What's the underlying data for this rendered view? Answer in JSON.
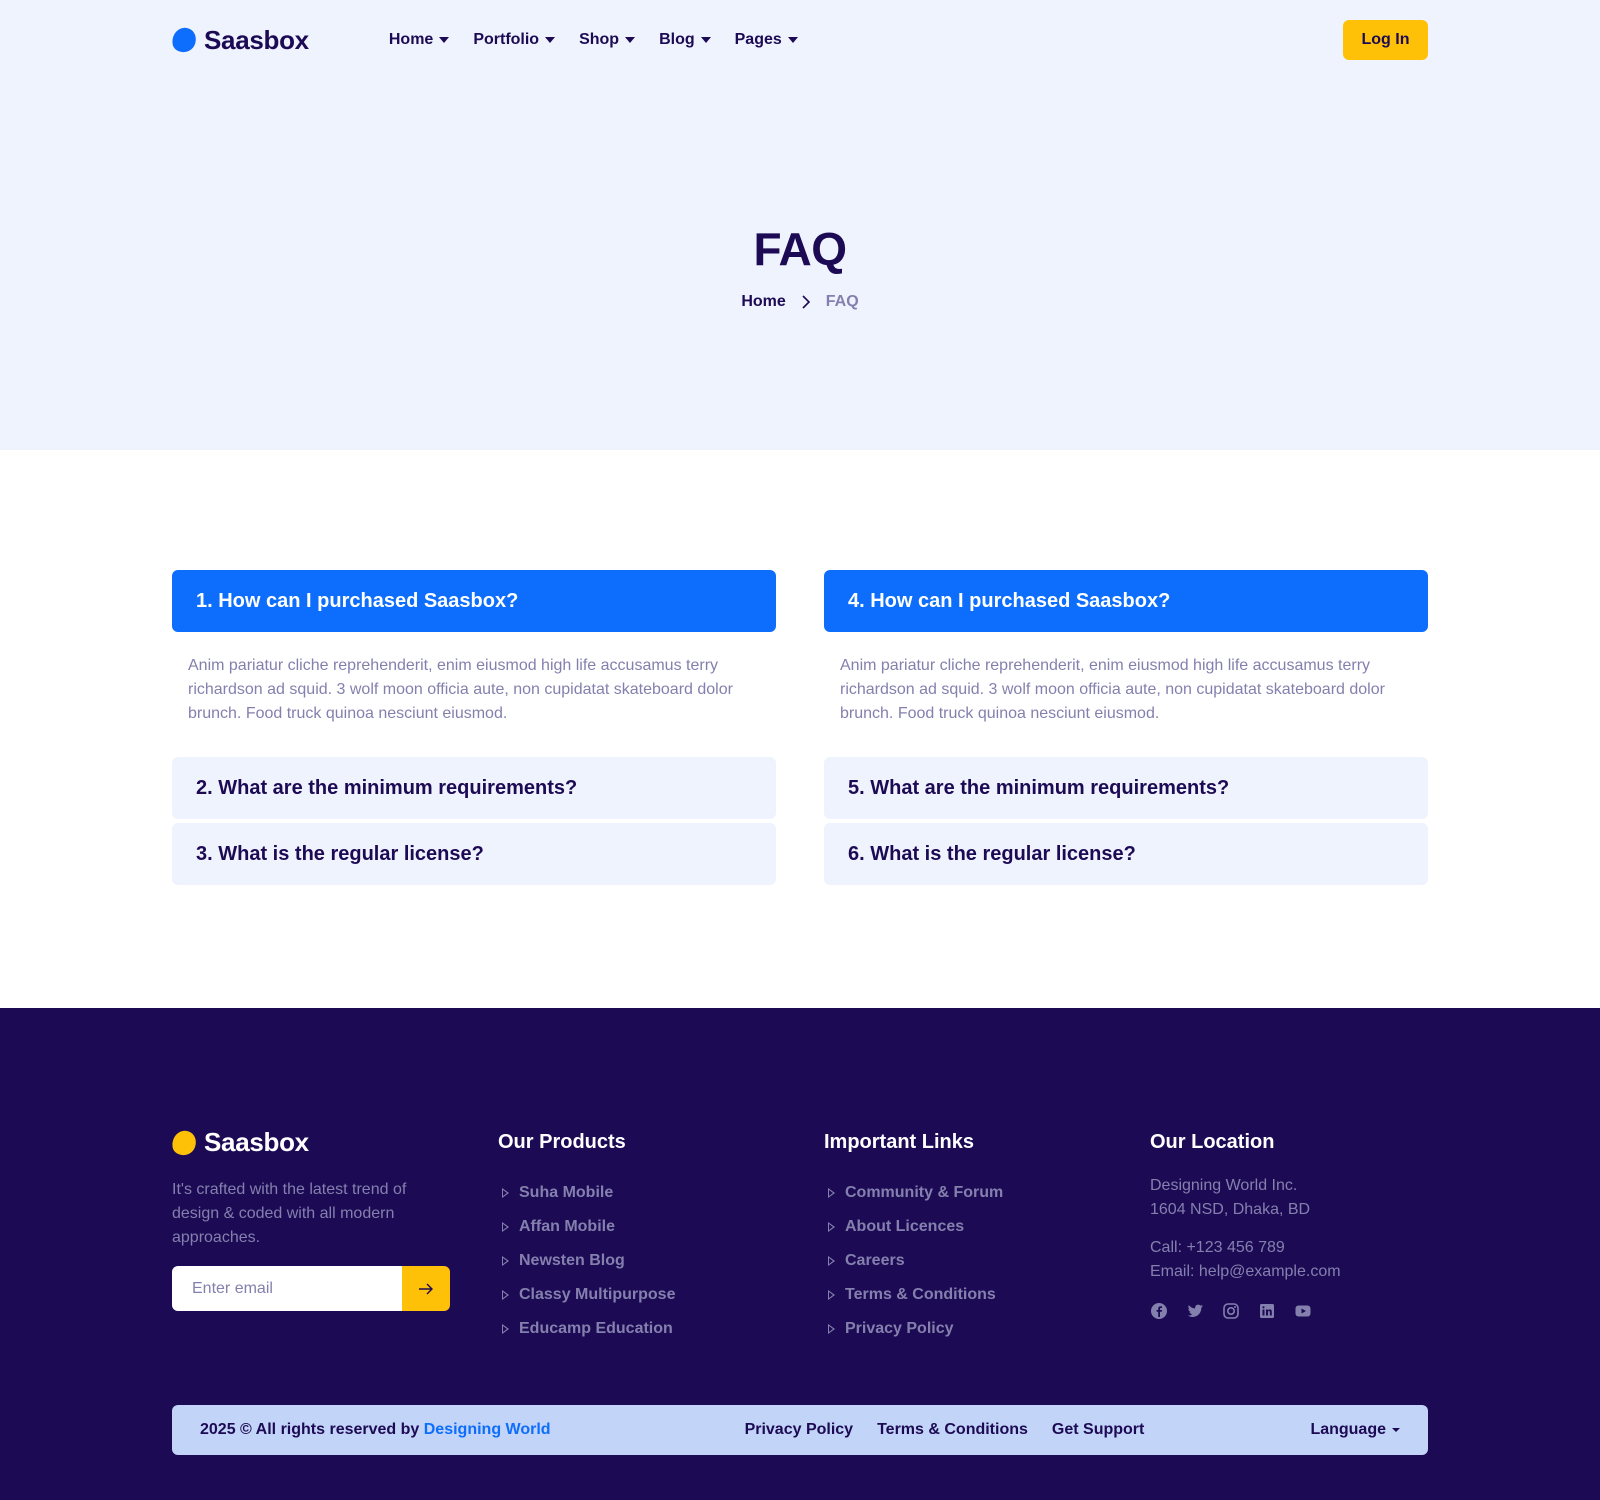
{
  "brand": {
    "name": "Saasbox"
  },
  "nav": {
    "items": [
      {
        "label": "Home"
      },
      {
        "label": "Portfolio"
      },
      {
        "label": "Shop"
      },
      {
        "label": "Blog"
      },
      {
        "label": "Pages"
      }
    ],
    "login_label": "Log In"
  },
  "hero": {
    "title": "FAQ",
    "breadcrumb": {
      "home": "Home",
      "current": "FAQ"
    }
  },
  "faq": {
    "left": [
      {
        "question": "1. How can I purchased Saasbox?",
        "answer": "Anim pariatur cliche reprehenderit, enim eiusmod high life accusamus terry richardson ad squid. 3 wolf moon officia aute, non cupidatat skateboard dolor brunch. Food truck quinoa nesciunt eiusmod.",
        "expanded": true
      },
      {
        "question": "2. What are the minimum requirements?",
        "expanded": false
      },
      {
        "question": "3. What is the regular license?",
        "expanded": false
      }
    ],
    "right": [
      {
        "question": "4. How can I purchased Saasbox?",
        "answer": "Anim pariatur cliche reprehenderit, enim eiusmod high life accusamus terry richardson ad squid. 3 wolf moon officia aute, non cupidatat skateboard dolor brunch. Food truck quinoa nesciunt eiusmod.",
        "expanded": true
      },
      {
        "question": "5. What are the minimum requirements?",
        "expanded": false
      },
      {
        "question": "6. What is the regular license?",
        "expanded": false
      }
    ]
  },
  "footer": {
    "brand": "Saasbox",
    "description": "It's crafted with the latest trend of design & coded with all modern approaches.",
    "email_placeholder": "Enter email",
    "products": {
      "heading": "Our Products",
      "items": [
        "Suha Mobile",
        "Affan Mobile",
        "Newsten Blog",
        "Classy Multipurpose",
        "Educamp Education"
      ]
    },
    "links": {
      "heading": "Important Links",
      "items": [
        "Community & Forum",
        "About Licences",
        "Careers",
        "Terms & Conditions",
        "Privacy Policy"
      ]
    },
    "location": {
      "heading": "Our Location",
      "address_line1": "Designing World Inc.",
      "address_line2": "1604 NSD, Dhaka, BD",
      "phone": "Call: +123 456 789",
      "email": "Email: help@example.com",
      "socials": [
        "facebook-icon",
        "twitter-icon",
        "instagram-icon",
        "linkedin-icon",
        "youtube-icon"
      ]
    },
    "bottom": {
      "copyright_prefix": "2025 © All rights reserved by ",
      "copyright_link": "Designing World",
      "links": [
        "Privacy Policy",
        "Terms & Conditions",
        "Get Support"
      ],
      "language_label": "Language"
    }
  },
  "colors": {
    "primary": "#0d6efd",
    "accent": "#ffc107",
    "navy": "#1d0a54",
    "muted": "#8480ae",
    "hero_bg": "#eff3fd",
    "bottom_bar_bg": "#c2d4f8"
  }
}
